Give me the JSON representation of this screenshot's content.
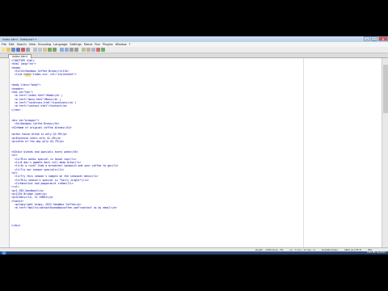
{
  "window": {
    "title": "index.html - Notepad++",
    "controls": [
      "—",
      "□",
      "✕"
    ]
  },
  "menubar": {
    "items": [
      "File",
      "Edit",
      "Search",
      "View",
      "Encoding",
      "Language",
      "Settings",
      "Macro",
      "Run",
      "Plugins",
      "Window",
      "?"
    ]
  },
  "tabs": [
    {
      "label": "index.html"
    }
  ],
  "code_lines": [
    "<!DOCTYPE html>",
    "<html lang=\"en\">",
    "<head>",
    "  <title>Sandbox Coffee Brews</title>",
    "  <link href=\"index.css\" rel=\"stylesheet\">",
    "",
    "",
    "<body class=\"body\">",
    "<header>",
    "<nav id=\"nav\">",
    "  <a href=\"index.html\">Home</a> |",
    "  <a href=\"menu.html\">Menu</a> |",
    "  <a href=\"locations.html\">Locations</a> |",
    "  <a href=\"contact.html\">Contact</a>",
    "</nav>",
    "",
    "",
    "<div id=\"wrapper\">",
    "  <h1>Sandbox Coffee Brews</h1>",
    "<h2>Home of original coffee blends</h2>",
    "",
    "<p>Our house blend is only $2.99</p>",
    "<p>Espresso shots only $1.49</p>",
    "<p>Latte of the day only $3.79</p>",
    "",
    "",
    "<h3>Our blends and specials every week</h3>",
    "<ul>",
    "  <li>This weeks special is house cup</li>",
    "  <li>A day's gamble dark roll deep brew</li>",
    "  <li>In a rush? Grab a breakfast sandwich and your coffee to go</li>",
    "  <li>Try our season specials</li>",
    "<ul>",
    "  <li>Try this season's sample on the seasonal menu</li>",
    "  <li>This season's special is \"Sorry Jingle\"</li>",
    "  <li>Hazelnut and peppermint crème</li>",
    "</ul>",
    "<p>1-555-SandboxC</p>",
    "<p>1234 Bridge Lane</p>",
    "<p>Greenville, SC 29601</p>",
    "<footer>",
    "  <p>Copyright &copy; 2012 Sandbox Coffee</p>",
    "  <a href=\"mailto:contact@sandboxcoffee.com\">contact us by email</a>",
    "",
    "",
    "",
    "",
    "</div>",
    "",
    ""
  ],
  "statusbar": {
    "length": "length : 1408  lines : 55",
    "position": "Ln : 5  Col : 21  Sel : 0",
    "eol": "Dos\\Windows",
    "encoding": "ANSI as UTF-8",
    "mode": "INS"
  },
  "taskbar": {
    "time": "9:55 PM",
    "date": "7/1/2012"
  },
  "colors": {
    "code_text": "#0000aa",
    "title_gradient_top": "#cfe0f3",
    "taskbar": "#1f3a5e"
  }
}
